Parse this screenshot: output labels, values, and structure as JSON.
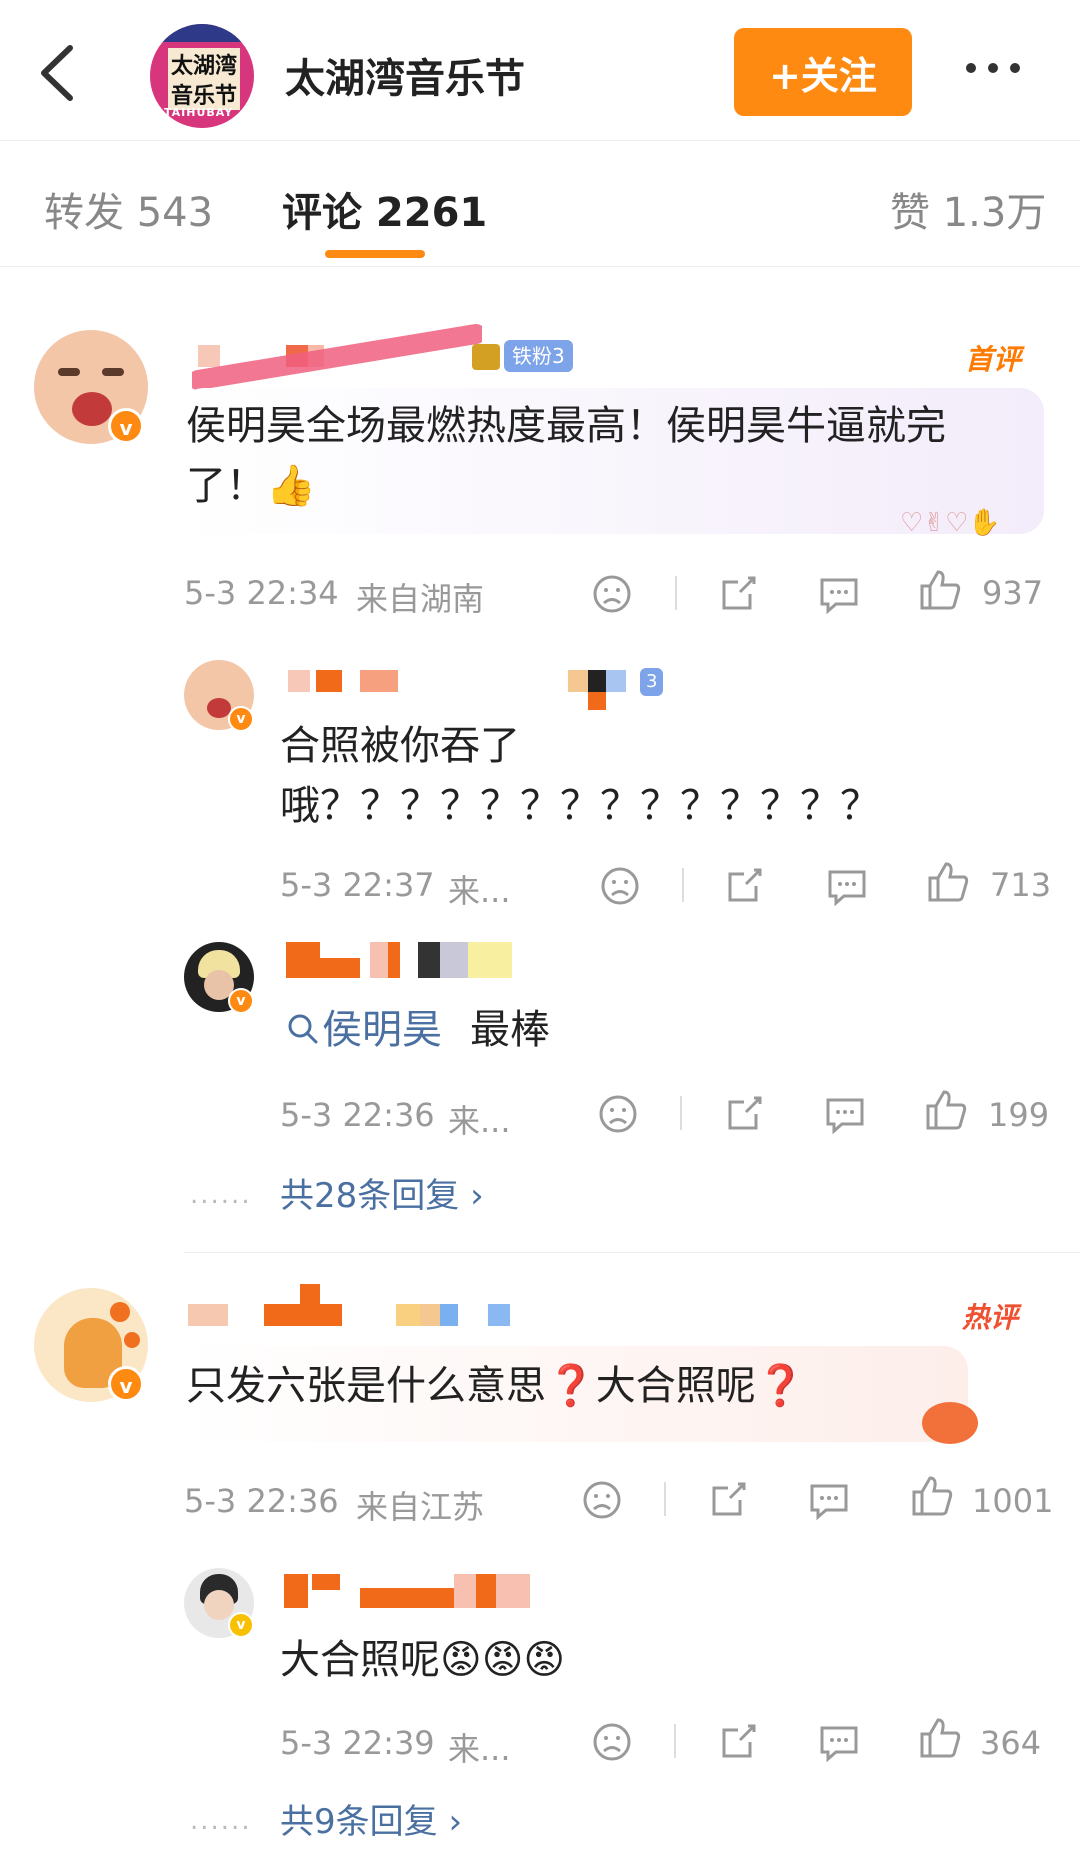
{
  "header": {
    "back_icon": "chevron-left-icon",
    "account_name": "太湖湾音乐节",
    "follow_label": "+关注",
    "more_icon": "more-horizontal-icon",
    "logo_lines": [
      "太湖湾",
      "音乐节",
      "TAIHUBAY"
    ]
  },
  "tabs": [
    {
      "label": "转发 543"
    },
    {
      "label": "评论 2261"
    },
    {
      "label": "赞 1.3万"
    }
  ],
  "comments": [
    {
      "tag": "首评",
      "fan_badge": "铁粉3",
      "text": "侯明昊全场最燃热度最高！侯明昊牛逼就完了！👍",
      "time": "5-3 22:34",
      "location": "来自湖南",
      "likes": "937"
    },
    {
      "tag": "热评",
      "text": "只发六张是什么意思❓大合照呢❓",
      "time": "5-3 22:36",
      "location": "来自江苏",
      "likes": "1001"
    }
  ],
  "replies": [
    {
      "fan_level": "3",
      "line1": "合照被你吞了",
      "line2": "哦？？？？？？？？？？？？？？",
      "time": "5-3 22:37",
      "location": "来...",
      "likes": "713"
    },
    {
      "search_term": "侯明昊",
      "text": "最棒",
      "time": "5-3 22:36",
      "location": "来...",
      "likes": "199"
    },
    {
      "text": "大合照呢😡😡😡",
      "time": "5-3 22:39",
      "location": "来...",
      "likes": "364"
    }
  ],
  "more_replies": [
    {
      "label": "共28条回复 ›",
      "dots": "......"
    },
    {
      "label": "共9条回复 ›",
      "dots": "......"
    }
  ],
  "colors": {
    "accent": "#ff8a11",
    "link": "#4a6fa1",
    "meta": "#999999"
  }
}
